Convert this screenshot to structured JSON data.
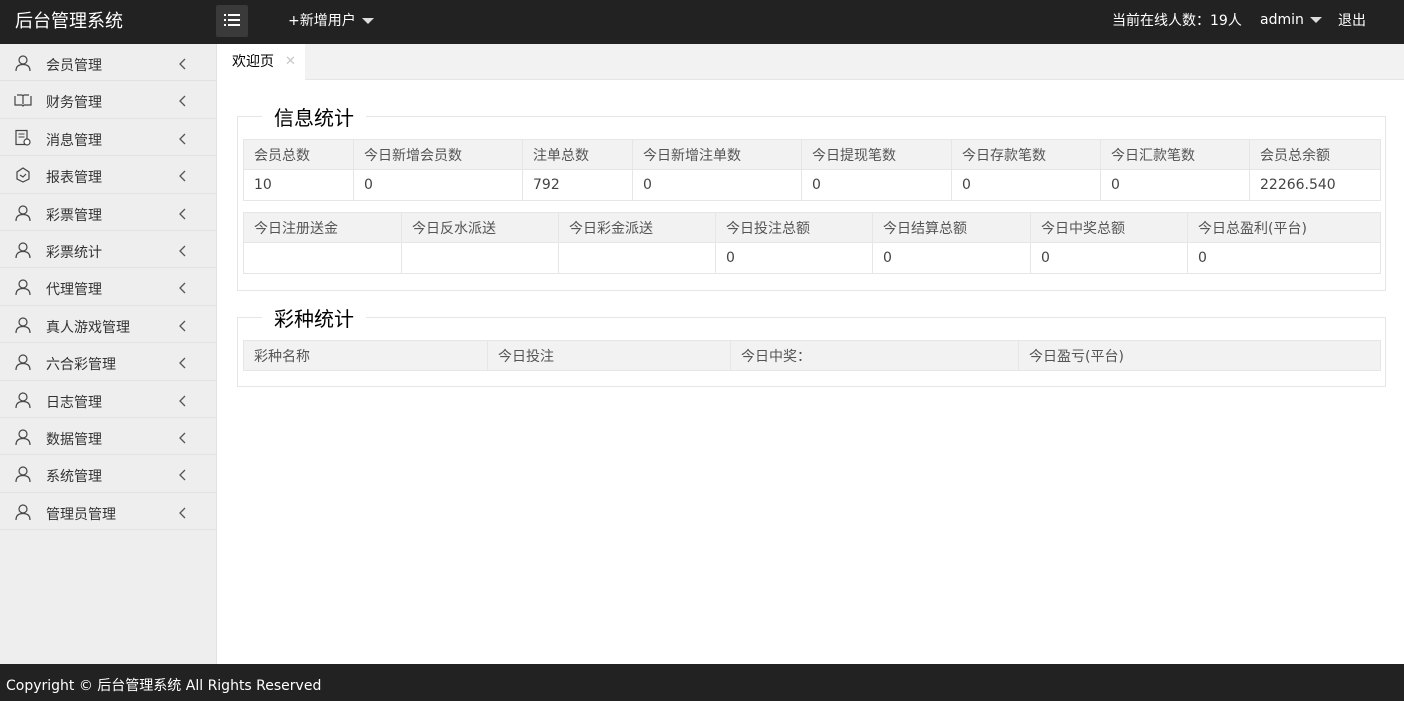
{
  "header": {
    "logo": "后台管理系统",
    "add_user": "+新增用户",
    "online": "当前在线人数：19人",
    "admin": "admin",
    "logout": "退出"
  },
  "sidebar": {
    "items": [
      {
        "label": "会员管理",
        "icon": "user-icon"
      },
      {
        "label": "财务管理",
        "icon": "book-icon"
      },
      {
        "label": "消息管理",
        "icon": "document-icon"
      },
      {
        "label": "报表管理",
        "icon": "report-icon"
      },
      {
        "label": "彩票管理",
        "icon": "user-icon"
      },
      {
        "label": "彩票统计",
        "icon": "user-icon"
      },
      {
        "label": "代理管理",
        "icon": "user-icon"
      },
      {
        "label": "真人游戏管理",
        "icon": "user-icon"
      },
      {
        "label": "六合彩管理",
        "icon": "user-icon"
      },
      {
        "label": "日志管理",
        "icon": "user-icon"
      },
      {
        "label": "数据管理",
        "icon": "user-icon"
      },
      {
        "label": "系统管理",
        "icon": "user-icon"
      },
      {
        "label": "管理员管理",
        "icon": "user-icon"
      }
    ]
  },
  "tabs": [
    {
      "label": "欢迎页",
      "close": "✕"
    }
  ],
  "info_stats": {
    "title": "信息统计",
    "table1": {
      "headers": [
        "会员总数",
        "今日新增会员数",
        "注单总数",
        "今日新增注单数",
        "今日提现笔数",
        "今日存款笔数",
        "今日汇款笔数",
        "会员总余额"
      ],
      "values": [
        "10",
        "0",
        "792",
        "0",
        "0",
        "0",
        "0",
        "22266.540"
      ]
    },
    "table2": {
      "headers": [
        "今日注册送金",
        "今日反水派送",
        "今日彩金派送",
        "今日投注总额",
        "今日结算总额",
        "今日中奖总额",
        "今日总盈利(平台)"
      ],
      "values": [
        "",
        "",
        "",
        "0",
        "0",
        "0",
        "0"
      ]
    }
  },
  "lottery_stats": {
    "title": "彩种统计",
    "headers": [
      "彩种名称",
      "今日投注",
      "今日中奖：",
      "今日盈亏(平台)"
    ]
  },
  "footer": {
    "copyright": "Copyright © 后台管理系统 All Rights Reserved"
  }
}
